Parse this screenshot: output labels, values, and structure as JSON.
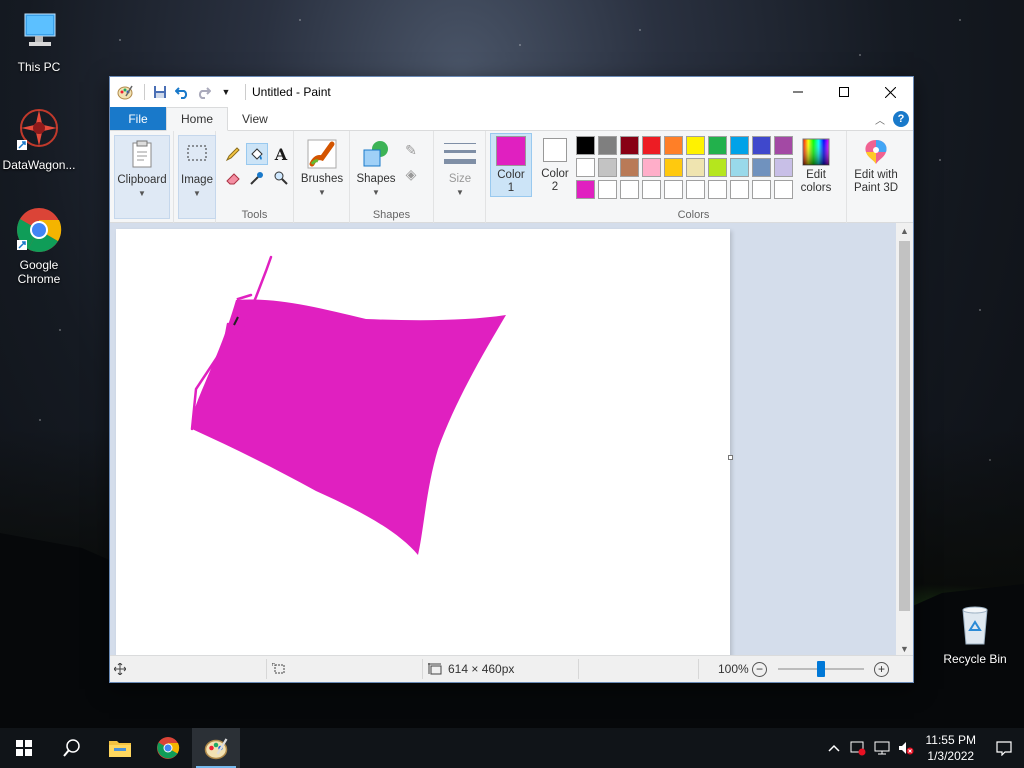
{
  "desktop": {
    "icons": [
      {
        "label": "This PC",
        "icon": "computer-icon"
      },
      {
        "label": "DataWagon...",
        "icon": "datawagon-icon"
      },
      {
        "label": "Google Chrome",
        "icon": "chrome-icon"
      },
      {
        "label": "Recycle Bin",
        "icon": "recycle-bin-icon"
      }
    ]
  },
  "window": {
    "title": "Untitled - Paint",
    "tabs": [
      {
        "label": "File"
      },
      {
        "label": "Home"
      },
      {
        "label": "View"
      }
    ],
    "ribbon": {
      "clipboard": {
        "label": "Clipboard"
      },
      "image": {
        "label": "Image"
      },
      "tools": {
        "group_label": "Tools",
        "selected": "fill-icon"
      },
      "brushes": {
        "label": "Brushes"
      },
      "shapes": {
        "label": "Shapes",
        "group_label": "Shapes"
      },
      "size": {
        "label": "Size"
      },
      "color1": {
        "label_top": "Color",
        "label_bottom": "1",
        "color": "#E020C0"
      },
      "color2": {
        "label_top": "Color",
        "label_bottom": "2",
        "color": "#FFFFFF"
      },
      "palette": {
        "group_label": "Colors",
        "row1": [
          "#000000",
          "#7F7F7F",
          "#880015",
          "#ED1C24",
          "#FF7F27",
          "#FFF200",
          "#22B14C",
          "#00A2E8",
          "#3F48CC",
          "#A349A4"
        ],
        "row2": [
          "#FFFFFF",
          "#C3C3C3",
          "#B97A57",
          "#FFAEC9",
          "#FFC90E",
          "#EFE4B0",
          "#B5E61D",
          "#99D9EA",
          "#7092BE",
          "#C8BFE7"
        ],
        "row3": [
          "#E020C0",
          "#FFFFFF",
          "#FFFFFF",
          "#FFFFFF",
          "#FFFFFF",
          "#FFFFFF",
          "#FFFFFF",
          "#FFFFFF",
          "#FFFFFF",
          "#FFFFFF"
        ]
      },
      "edit_colors": {
        "label_top": "Edit",
        "label_bottom": "colors"
      },
      "paint3d": {
        "label_top": "Edit with",
        "label_bottom": "Paint 3D"
      }
    },
    "canvas": {
      "fill_color": "#E020C0"
    },
    "status": {
      "size": "614 × 460px",
      "zoom": "100%",
      "zoom_level": 1.0
    }
  },
  "taskbar": {
    "apps": [
      "start-icon",
      "search-icon",
      "file-explorer-icon",
      "chrome-icon",
      "paint-icon"
    ],
    "active_app": "paint-icon",
    "time": "11:55 PM",
    "date": "1/3/2022"
  }
}
